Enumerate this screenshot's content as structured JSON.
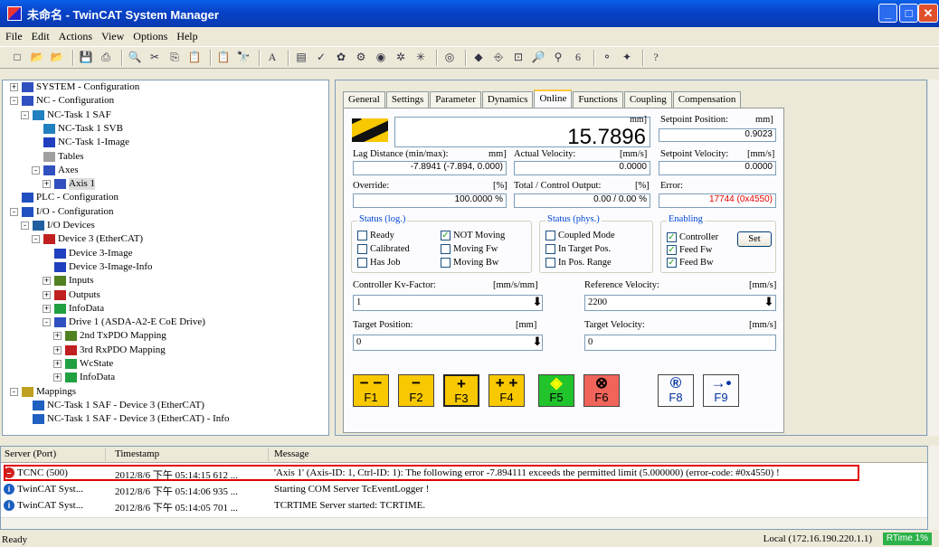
{
  "window": {
    "title": "未命名 - TwinCAT System Manager"
  },
  "menu": [
    "File",
    "Edit",
    "Actions",
    "View",
    "Options",
    "Help"
  ],
  "toolbar_icons": [
    "new-icon",
    "open-icon",
    "open-target-icon",
    "save-icon",
    "print-icon",
    "preview-icon",
    "cut-icon",
    "copy-icon",
    "paste-icon",
    "paste-link-icon",
    "find-icon",
    "replace-icon",
    "devices-icon",
    "activate-config-icon",
    "check-icon",
    "build-icon",
    "scan-icon",
    "run-mode-icon",
    "config-mode-icon",
    "reload-icon",
    "toggle-icon",
    "link-icon",
    "dock-icon",
    "zoom-icon",
    "map-icon",
    "fx-icon",
    "online-icon",
    "pdo-icon",
    "help-icon"
  ],
  "tree": [
    {
      "label": "SYSTEM - Configuration",
      "level": 0,
      "exp": "+"
    },
    {
      "label": "NC - Configuration",
      "level": 0,
      "exp": "-"
    },
    {
      "label": "NC-Task 1 SAF",
      "level": 1,
      "exp": "-"
    },
    {
      "label": "NC-Task 1 SVB",
      "level": 2,
      "exp": ""
    },
    {
      "label": "NC-Task 1-Image",
      "level": 2,
      "exp": ""
    },
    {
      "label": "Tables",
      "level": 2,
      "exp": ""
    },
    {
      "label": "Axes",
      "level": 2,
      "exp": "-"
    },
    {
      "label": "Axis 1",
      "level": 3,
      "exp": "+",
      "selected": true
    },
    {
      "label": "PLC - Configuration",
      "level": 0,
      "exp": ""
    },
    {
      "label": "I/O - Configuration",
      "level": 0,
      "exp": "-"
    },
    {
      "label": "I/O Devices",
      "level": 1,
      "exp": "-"
    },
    {
      "label": "Device 3 (EtherCAT)",
      "level": 2,
      "exp": "-"
    },
    {
      "label": "Device 3-Image",
      "level": 3,
      "exp": ""
    },
    {
      "label": "Device 3-Image-Info",
      "level": 3,
      "exp": ""
    },
    {
      "label": "Inputs",
      "level": 3,
      "exp": "+"
    },
    {
      "label": "Outputs",
      "level": 3,
      "exp": "+"
    },
    {
      "label": "InfoData",
      "level": 3,
      "exp": "+"
    },
    {
      "label": "Drive 1 (ASDA-A2-E CoE Drive)",
      "level": 3,
      "exp": "-"
    },
    {
      "label": "2nd TxPDO Mapping",
      "level": 4,
      "exp": "+"
    },
    {
      "label": "3rd RxPDO Mapping",
      "level": 4,
      "exp": "+"
    },
    {
      "label": "WcState",
      "level": 4,
      "exp": "+"
    },
    {
      "label": "InfoData",
      "level": 4,
      "exp": "+"
    },
    {
      "label": "Mappings",
      "level": 0,
      "exp": "-"
    },
    {
      "label": "NC-Task 1 SAF - Device 3 (EtherCAT)",
      "level": 1,
      "exp": ""
    },
    {
      "label": "NC-Task 1 SAF - Device 3 (EtherCAT) - Info",
      "level": 1,
      "exp": ""
    }
  ],
  "tabs": [
    "General",
    "Settings",
    "Parameter",
    "Dynamics",
    "Online",
    "Functions",
    "Coupling",
    "Compensation"
  ],
  "online": {
    "position_unit": "mm]",
    "position": "15.7896",
    "setpoint_position_label": "Setpoint Position:",
    "setpoint_position_unit": "mm]",
    "setpoint_position": "0.9023",
    "lag_label": "Lag Distance (min/max):",
    "lag_unit": "mm]",
    "lag": "-7.8941  (-7.894, 0.000)",
    "actual_velocity_label": "Actual Velocity:",
    "actual_velocity_unit": "[mm/s]",
    "actual_velocity": "0.0000",
    "setpoint_velocity_label": "Setpoint Velocity:",
    "setpoint_velocity_unit": "[mm/s]",
    "setpoint_velocity": "0.0000",
    "override_label": "Override:",
    "override_unit": "[%]",
    "override": "100.0000 %",
    "total_output_label": "Total / Control Output:",
    "total_output_unit": "[%]",
    "total_output": "0.00 / 0.00 %",
    "error_label": "Error:",
    "error": "17744 (0x4550)"
  },
  "status_log": {
    "title": "Status (log.)",
    "items": [
      {
        "label": "Ready",
        "checked": false
      },
      {
        "label": "NOT Moving",
        "checked": true
      },
      {
        "label": "Calibrated",
        "checked": false
      },
      {
        "label": "Moving Fw",
        "checked": false
      },
      {
        "label": "Has Job",
        "checked": false
      },
      {
        "label": "Moving Bw",
        "checked": false
      }
    ]
  },
  "status_phys": {
    "title": "Status (phys.)",
    "items": [
      {
        "label": "Coupled Mode",
        "checked": false
      },
      {
        "label": "In Target Pos.",
        "checked": false
      },
      {
        "label": "In Pos. Range",
        "checked": false
      }
    ]
  },
  "enabling": {
    "title": "Enabling",
    "items": [
      {
        "label": "Controller",
        "checked": true
      },
      {
        "label": "Feed Fw",
        "checked": true
      },
      {
        "label": "Feed Bw",
        "checked": true
      }
    ],
    "set_label": "Set"
  },
  "params": {
    "kv_label": "Controller Kv-Factor:",
    "kv_unit": "[mm/s/mm]",
    "kv_value": "1",
    "ref_vel_label": "Reference Velocity:",
    "ref_vel_unit": "[mm/s]",
    "ref_vel_value": "2200",
    "target_pos_label": "Target Position:",
    "target_pos_unit": "[mm]",
    "target_pos_value": "0",
    "target_vel_label": "Target Velocity:",
    "target_vel_unit": "[mm/s]",
    "target_vel_value": "0"
  },
  "fkeys": [
    {
      "sym": "− −",
      "label": "F1",
      "color": "#f8c800"
    },
    {
      "sym": "−",
      "label": "F2",
      "color": "#f8c800"
    },
    {
      "sym": "+",
      "label": "F3",
      "color": "#f8c800"
    },
    {
      "sym": "+ +",
      "label": "F4",
      "color": "#f8c800"
    },
    {
      "sym": "◈",
      "label": "F5",
      "color": "#22c42c"
    },
    {
      "sym": "⊗",
      "label": "F6",
      "color": "#f0645a"
    },
    {
      "sym": "®",
      "label": "F8",
      "color": "#fcfcfe"
    },
    {
      "sym": "→•",
      "label": "F9",
      "color": "#fcfcfe"
    }
  ],
  "log": {
    "headers": [
      "Server (Port)",
      "Timestamp",
      "Message"
    ],
    "rows": [
      {
        "server": "TCNC (500)",
        "time": "2012/8/6 下午 05:14:15 612 ...",
        "msg": "'Axis 1' (Axis-ID: 1, Ctrl-ID: 1): The following error -7.894111 exceeds the permitted limit (5.000000) (error-code: #0x4550) !",
        "kind": "error"
      },
      {
        "server": "TwinCAT Syst...",
        "time": "2012/8/6 下午 05:14:06 935 ...",
        "msg": "Starting COM Server TcEventLogger !",
        "kind": "info"
      },
      {
        "server": "TwinCAT Syst...",
        "time": "2012/8/6 下午 05:14:05 701 ...",
        "msg": "TCRTIME Server started: TCRTIME.",
        "kind": "info"
      }
    ]
  },
  "status": {
    "left": "Ready",
    "right": "Local (172.16.190.220.1.1)",
    "rt": "RTime 1%"
  },
  "colors": {
    "error_red": "#e60000",
    "highlight_box": "#e00000"
  }
}
